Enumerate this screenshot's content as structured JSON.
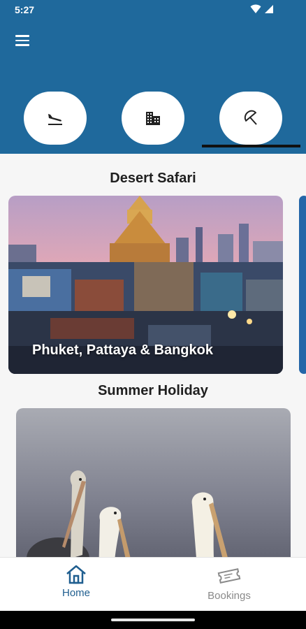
{
  "status_bar": {
    "time": "5:27"
  },
  "app_bar": {
    "menu_icon": "hamburger-menu-icon",
    "categories": [
      {
        "icon": "flight-land-icon"
      },
      {
        "icon": "hotel-building-icon"
      },
      {
        "icon": "beach-umbrella-icon",
        "selected": true
      }
    ]
  },
  "sections": [
    {
      "title": "Desert Safari",
      "cards": [
        {
          "label": "Phuket, Pattaya & Bangkok"
        }
      ]
    },
    {
      "title": "Summer Holiday",
      "cards": [
        {
          "label": ""
        }
      ]
    }
  ],
  "bottom_nav": {
    "items": [
      {
        "label": "Home",
        "icon": "home-icon",
        "active": true
      },
      {
        "label": "Bookings",
        "icon": "ticket-icon",
        "active": false
      }
    ]
  },
  "colors": {
    "primary": "#1f699c",
    "active_nav": "#1f5e8f",
    "inactive_nav": "#8a8a8a"
  }
}
